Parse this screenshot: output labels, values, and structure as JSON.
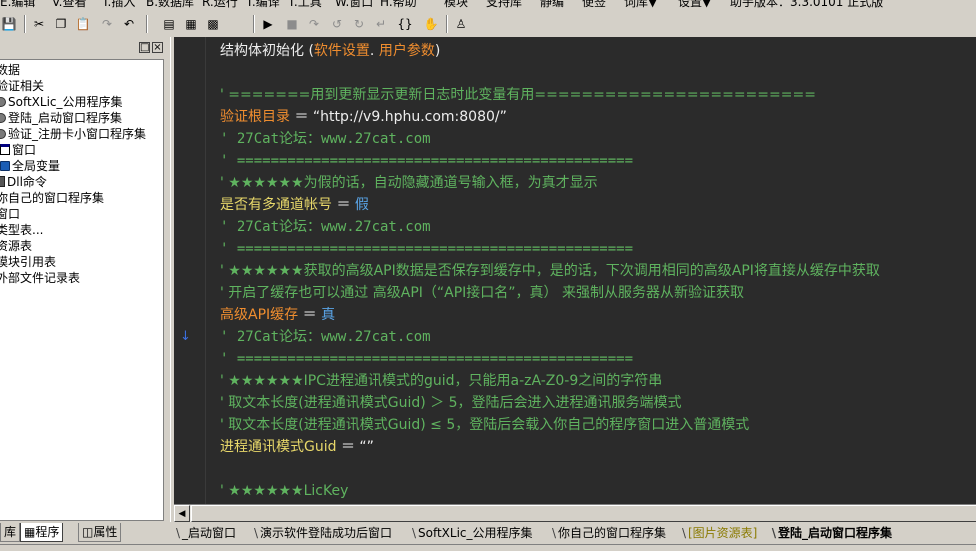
{
  "menu": [
    "E.编辑",
    "V.查看",
    "I.插入",
    "B.数据库",
    "R.运行",
    "T.编译",
    "T.工具",
    "W.窗口",
    "H.帮助",
    "模块",
    "支持库",
    "静编",
    "便签",
    "词库▼",
    "设置▼",
    "助手版本：3.3.0101 正式版"
  ],
  "toolbar": {
    "icons": [
      "save-icon",
      "cut-icon",
      "copy-icon",
      "paste-icon",
      "redo-icon",
      "undo-icon",
      "layout-1-icon",
      "layout-2-icon",
      "layout-3-icon",
      "run-icon",
      "stop-icon",
      "step-into-icon",
      "step-over-icon",
      "step-out-icon",
      "run-to-cursor-icon",
      "breakpoint-icon",
      "hand-icon",
      "user-icon"
    ]
  },
  "left_panel": {
    "header_buttons": [
      "□",
      "×"
    ],
    "tree": [
      {
        "label": "数据",
        "icon": "none"
      },
      {
        "label": "验证相关",
        "icon": "none"
      },
      {
        "label": "SoftXLic_公用程序集",
        "icon": "gear"
      },
      {
        "label": "登陆_启动窗口程序集",
        "icon": "gear"
      },
      {
        "label": "验证_注册卡小窗口程序集",
        "icon": "gear"
      },
      {
        "label": "窗口",
        "icon": "win"
      },
      {
        "label": "全局变量",
        "icon": "glob"
      },
      {
        "label": "Dll命令",
        "icon": "dll"
      },
      {
        "label": "你自己的窗口程序集",
        "icon": "none"
      },
      {
        "label": "窗口",
        "icon": "none"
      },
      {
        "label": "类型表...",
        "icon": "none"
      },
      {
        "label": "资源表",
        "icon": "none"
      },
      {
        "label": "模块引用表",
        "icon": "none"
      },
      {
        "label": "外部文件记录表",
        "icon": "none"
      }
    ],
    "tabs": [
      "库",
      "程序",
      "属性"
    ]
  },
  "editor": {
    "lines": [
      [
        {
          "t": "结构体初始化 (",
          "c": "white"
        },
        {
          "t": "软件设置",
          "c": "orange"
        },
        {
          "t": ". ",
          "c": "white"
        },
        {
          "t": "用户参数",
          "c": "orange"
        },
        {
          "t": ")",
          "c": "white"
        }
      ],
      [],
      [
        {
          "t": "' =======用到更新显示更新日志时此变量有用========================",
          "c": "green"
        }
      ],
      [
        {
          "t": "验证根目录",
          "c": "orange"
        },
        {
          "t": " ＝ ",
          "c": "white"
        },
        {
          "t": "“http://v9.hphu.com:8080/”",
          "c": "white"
        }
      ],
      [
        {
          "t": "' 27Cat论坛：www.27cat.com",
          "c": "green",
          "mono": true
        }
      ],
      [
        {
          "t": "' ===============================================",
          "c": "green",
          "mono": true
        }
      ],
      [
        {
          "t": "' ★★★★★★为假的话，自动隐藏通道号输入框，为真才显示",
          "c": "green"
        }
      ],
      [
        {
          "t": "是否有多通道帐号",
          "c": "yellow"
        },
        {
          "t": " ＝ ",
          "c": "white"
        },
        {
          "t": "假",
          "c": "blue"
        }
      ],
      [
        {
          "t": "' 27Cat论坛：www.27cat.com",
          "c": "green",
          "mono": true
        }
      ],
      [
        {
          "t": "' ===============================================",
          "c": "green",
          "mono": true
        }
      ],
      [
        {
          "t": "' ★★★★★★获取的高级API数据是否保存到缓存中，是的话，下次调用相同的高级API将直接从缓存中获取",
          "c": "green"
        }
      ],
      [
        {
          "t": "' 开启了缓存也可以通过 高级API（“API接口名”，真） 来强制从服务器从新验证获取",
          "c": "green"
        }
      ],
      [
        {
          "t": "高级API缓存",
          "c": "orange"
        },
        {
          "t": " ＝ ",
          "c": "white"
        },
        {
          "t": "真",
          "c": "blue"
        }
      ],
      [
        {
          "t": "' 27Cat论坛：www.27cat.com",
          "c": "green",
          "mono": true
        }
      ],
      [
        {
          "t": "' ===============================================",
          "c": "green",
          "mono": true
        }
      ],
      [
        {
          "t": "' ★★★★★★IPC进程通讯模式的guid，只能用a-zA-Z0-9之间的字符串",
          "c": "green"
        }
      ],
      [
        {
          "t": "' 取文本长度(进程通讯模式Guid) ＞ 5，登陆后会进入进程通讯服务端模式",
          "c": "green"
        }
      ],
      [
        {
          "t": "' 取文本长度(进程通讯模式Guid) ≤ 5，登陆后会载入你自己的程序窗口进入普通模式",
          "c": "green"
        }
      ],
      [
        {
          "t": "进程通讯模式Guid",
          "c": "yellow"
        },
        {
          "t": " ＝ ",
          "c": "white"
        },
        {
          "t": "“”",
          "c": "white"
        }
      ],
      [],
      [
        {
          "t": "' ★★★★★★LicKey",
          "c": "green"
        }
      ]
    ],
    "breakpoint_marker": "↓"
  },
  "bottom_tabs": [
    {
      "label": "_启动窗口",
      "style": "normal"
    },
    {
      "label": "演示软件登陆成功后窗口",
      "style": "normal"
    },
    {
      "label": "SoftXLic_公用程序集",
      "style": "normal"
    },
    {
      "label": "你自己的窗口程序集",
      "style": "normal"
    },
    {
      "label": "[图片资源表]",
      "style": "res"
    },
    {
      "label": "登陆_启动窗口程序集",
      "style": "active"
    }
  ]
}
